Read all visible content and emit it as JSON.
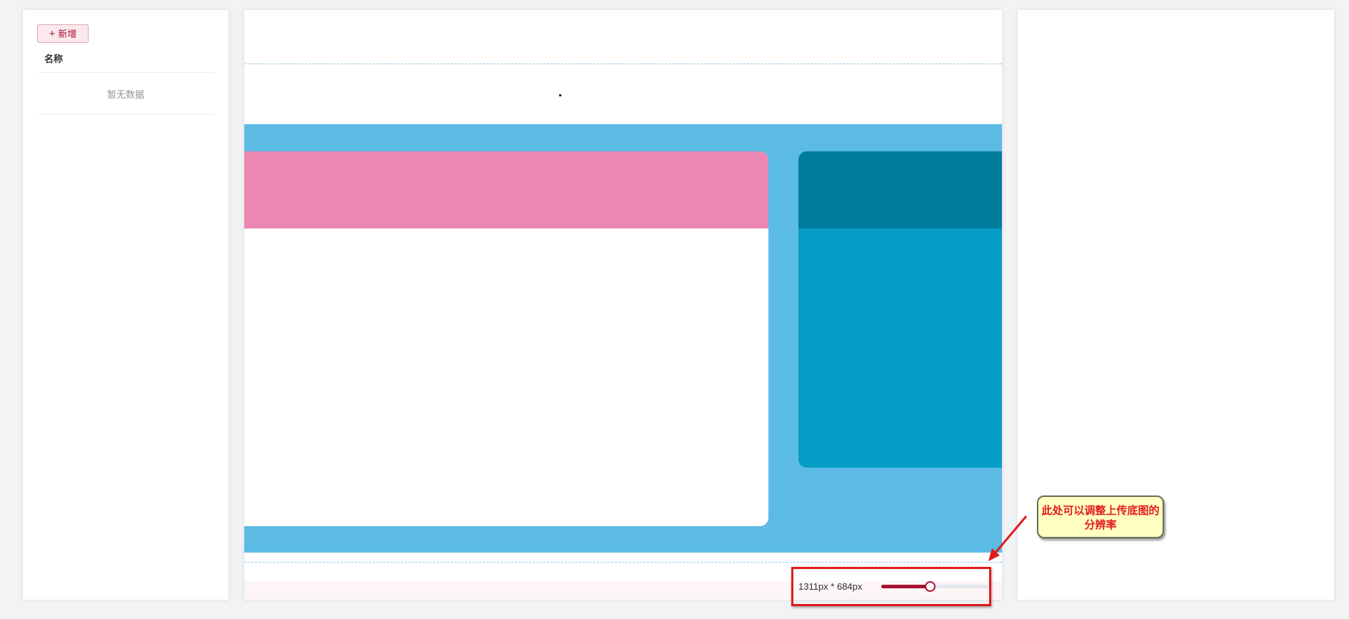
{
  "left_panel": {
    "add_button": {
      "icon": "plus-icon",
      "label": "新增"
    },
    "table": {
      "column_name": "名称",
      "empty_text": "暂无数据"
    }
  },
  "canvas": {
    "colors": {
      "background": "#5bbbe4",
      "left_card_header": "#ec87b3",
      "right_card_body": "#059dc6",
      "right_card_header": "#007c9d"
    }
  },
  "resolution": {
    "text": "1311px * 684px",
    "level_percent": 45
  },
  "annotation": {
    "callout_text": "此处可以调整上传底图的分辨率",
    "color": "#e11b1b"
  }
}
